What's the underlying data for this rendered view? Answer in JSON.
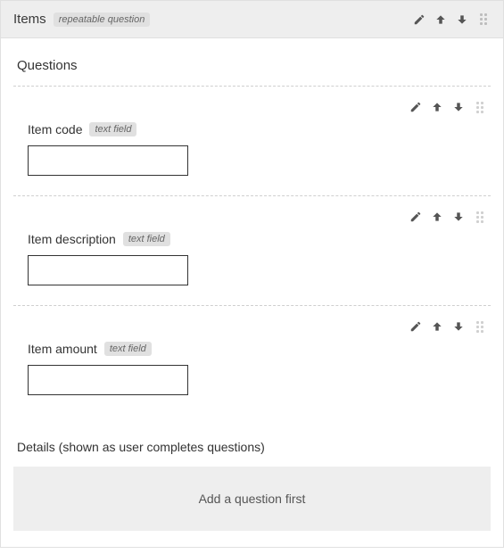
{
  "panel": {
    "title": "Items",
    "type_tag": "repeatable question"
  },
  "sections": {
    "questions_heading": "Questions",
    "details_heading": "Details (shown as user completes questions)",
    "details_placeholder": "Add a question first"
  },
  "questions": [
    {
      "label": "Item code",
      "type_tag": "text field",
      "value": ""
    },
    {
      "label": "Item description",
      "type_tag": "text field",
      "value": ""
    },
    {
      "label": "Item amount",
      "type_tag": "text field",
      "value": ""
    }
  ],
  "icons": {
    "edit": "edit-icon",
    "move_up": "arrow-up-icon",
    "move_down": "arrow-down-icon",
    "drag": "drag-handle-icon"
  }
}
